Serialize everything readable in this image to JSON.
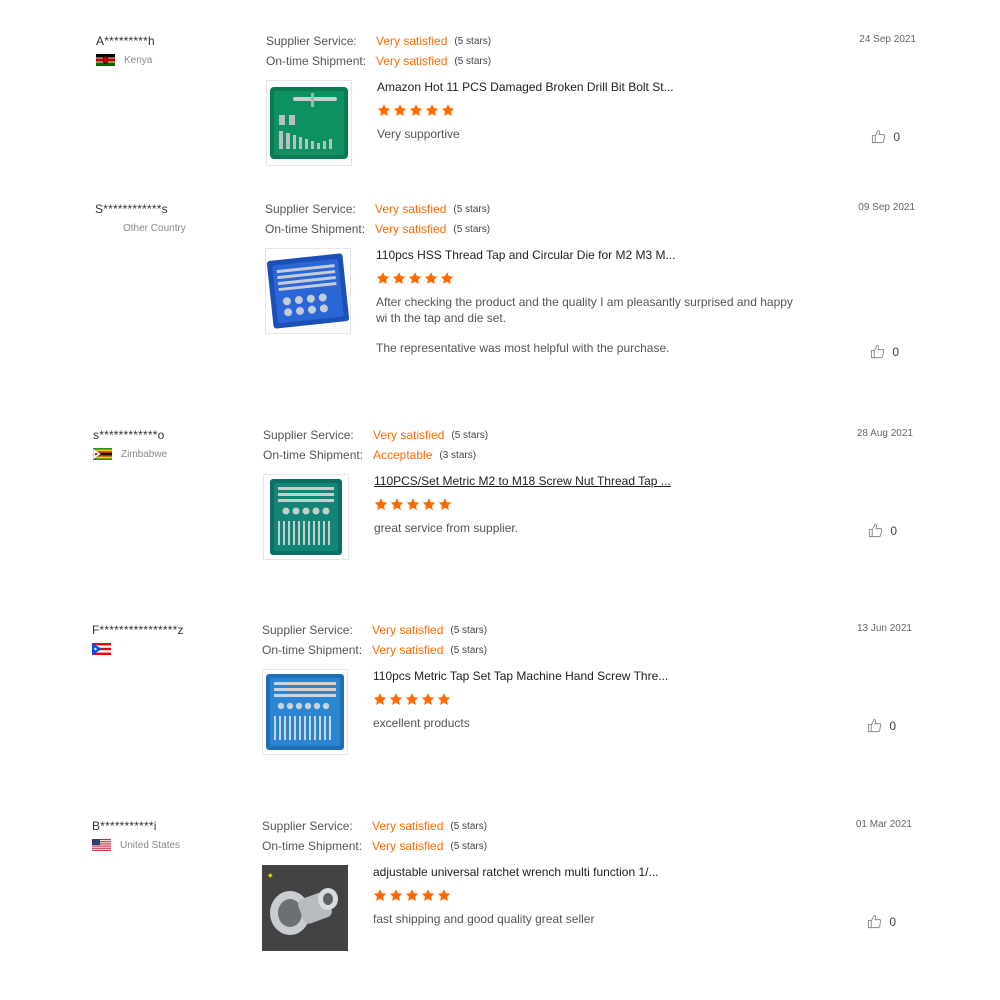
{
  "labels": {
    "supplier_service": "Supplier Service:",
    "ontime_shipment": "On-time Shipment:"
  },
  "colors": {
    "accent": "#ff6a00"
  },
  "reviews": [
    {
      "buyer": "A*********h",
      "country": "Kenya",
      "flag": "kenya-flag",
      "supplier_rating": "Very satisfied",
      "supplier_stars": "(5 stars)",
      "shipment_rating": "Very satisfied",
      "shipment_stars": "(5 stars)",
      "date": "24 Sep 2021",
      "product_title": "Amazon Hot 11 PCS Damaged Broken Drill Bit Bolt St...",
      "product_image": "green-extractor-kit",
      "rating": 5,
      "feedback": [
        "Very supportive"
      ],
      "helpful_count": "0"
    },
    {
      "buyer": "S************s",
      "country": "Other Country",
      "flag": "none",
      "supplier_rating": "Very satisfied",
      "supplier_stars": "(5 stars)",
      "shipment_rating": "Very satisfied",
      "shipment_stars": "(5 stars)",
      "date": "09 Sep 2021",
      "product_title": "110pcs HSS Thread Tap and Circular Die for M2 M3 M...",
      "product_image": "blue-tap-die-set",
      "rating": 5,
      "feedback": [
        "After checking the product and the quality I am pleasantly surprised and happy wi th the tap and die set.",
        "The representative was most helpful with the purchase."
      ],
      "helpful_count": "0"
    },
    {
      "buyer": "s************o",
      "country": "Zimbabwe",
      "flag": "zimbabwe-flag",
      "supplier_rating": "Very satisfied",
      "supplier_stars": "(5 stars)",
      "shipment_rating": "Acceptable",
      "shipment_stars": "(3 stars)",
      "date": "28 Aug 2021",
      "product_title": "110PCS/Set Metric M2 to M18 Screw Nut Thread Tap ...",
      "product_image": "teal-tap-set",
      "rating": 5,
      "feedback": [
        "great service from supplier."
      ],
      "helpful_count": "0"
    },
    {
      "buyer": "F****************z",
      "country": "",
      "flag": "puerto-rico-flag",
      "supplier_rating": "Very satisfied",
      "supplier_stars": "(5 stars)",
      "shipment_rating": "Very satisfied",
      "shipment_stars": "(5 stars)",
      "date": "13 Jun 2021",
      "product_title": "110pcs Metric Tap Set Tap Machine Hand Screw Thre...",
      "product_image": "blue-tap-set",
      "rating": 5,
      "feedback": [
        "excellent products"
      ],
      "helpful_count": "0"
    },
    {
      "buyer": "B***********i",
      "country": "United States",
      "flag": "us-flag",
      "supplier_rating": "Very satisfied",
      "supplier_stars": "(5 stars)",
      "shipment_rating": "Very satisfied",
      "shipment_stars": "(5 stars)",
      "date": "01 Mar 2021",
      "product_title": "adjustable universal ratchet wrench multi function 1/...",
      "product_image": "universal-socket-wrench",
      "rating": 5,
      "feedback": [
        "fast shipping and good quality great seller"
      ],
      "helpful_count": "0"
    }
  ]
}
